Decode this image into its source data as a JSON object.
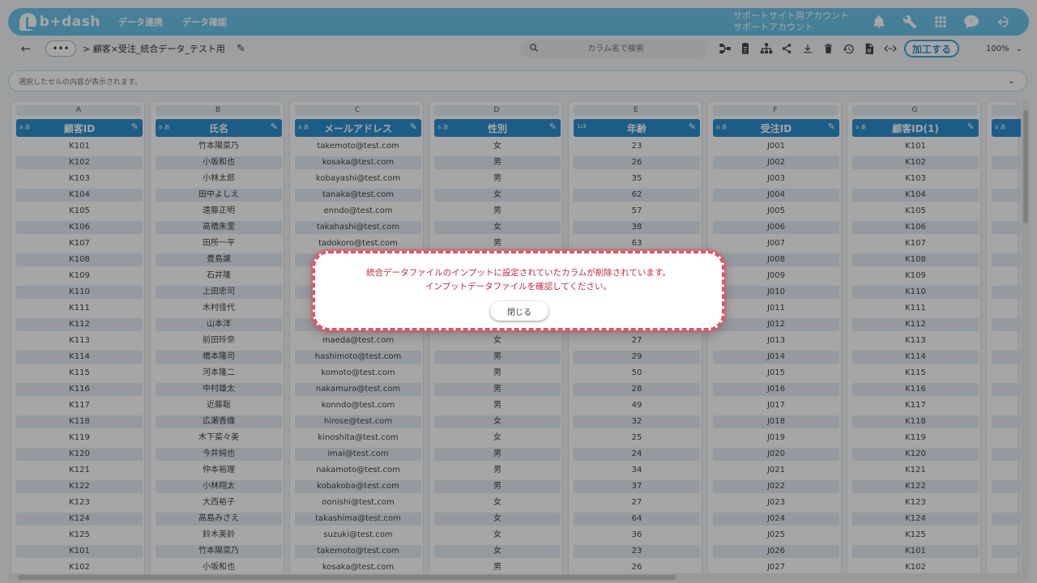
{
  "app": {
    "logo_text": "b+dash",
    "nav": [
      "データ連携",
      "データ確認"
    ],
    "account_line1": "サポートサイト用アカウント",
    "account_line2": "サポートアカウント"
  },
  "toolbar": {
    "more_label": "•••",
    "breadcrumb": "> 顧客×受注_統合データ_テスト用",
    "search_placeholder": "カラム名で検索",
    "process_label": "加工する",
    "zoom": "100%"
  },
  "cellbar": {
    "text": "選択したセルの内容が表示されます。"
  },
  "columns": [
    {
      "letter": "A",
      "type": "a あ",
      "name": "顧客ID",
      "values": [
        "K101",
        "K102",
        "K103",
        "K104",
        "K105",
        "K106",
        "K107",
        "K108",
        "K109",
        "K110",
        "K111",
        "K112",
        "K113",
        "K114",
        "K115",
        "K116",
        "K117",
        "K118",
        "K119",
        "K120",
        "K121",
        "K122",
        "K123",
        "K124",
        "K125",
        "K101",
        "K102"
      ]
    },
    {
      "letter": "B",
      "type": "a あ",
      "name": "氏名",
      "values": [
        "竹本陽菜乃",
        "小坂和也",
        "小林太郎",
        "田中よしえ",
        "遠藤正明",
        "高橋朱里",
        "田所一平",
        "豊島譲",
        "石井隆",
        "上田忠司",
        "木村佳代",
        "山本洋",
        "前田玲奈",
        "橋本隆司",
        "河本隆二",
        "中村雄太",
        "近藤聡",
        "広瀬香織",
        "木下菜々美",
        "今井純也",
        "仲本裕理",
        "小林翔太",
        "大西裕子",
        "高島みさえ",
        "鈴木美鈴",
        "竹本陽菜乃",
        "小坂和也"
      ]
    },
    {
      "letter": "C",
      "type": "a あ",
      "name": "メールアドレス",
      "values": [
        "takemoto@test.com",
        "kosaka@test.com",
        "kobayashi@test.com",
        "tanaka@test.com",
        "enndo@test.com",
        "takahashi@test.com",
        "tadokoro@test.com",
        "",
        "",
        "",
        "",
        "",
        "maeda@test.com",
        "hashimoto@test.com",
        "komoto@test.com",
        "nakamura@test.com",
        "konndo@test.com",
        "hirose@test.com",
        "kinoshita@test.com",
        "imai@test.com",
        "nakamoto@test.com",
        "kobakoba@test.com",
        "oonishi@test.com",
        "takashima@test.com",
        "suzuki@test.com",
        "takemoto@test.com",
        "kosaka@test.com"
      ]
    },
    {
      "letter": "D",
      "type": "a あ",
      "name": "性別",
      "values": [
        "女",
        "男",
        "男",
        "女",
        "男",
        "女",
        "男",
        "",
        "",
        "",
        "",
        "",
        "女",
        "男",
        "男",
        "男",
        "男",
        "女",
        "女",
        "男",
        "男",
        "男",
        "女",
        "女",
        "女",
        "女",
        "男"
      ]
    },
    {
      "letter": "E",
      "type": "1₂3",
      "name": "年齢",
      "values": [
        "23",
        "26",
        "35",
        "62",
        "57",
        "38",
        "63",
        "",
        "",
        "",
        "",
        "",
        "27",
        "29",
        "50",
        "28",
        "49",
        "32",
        "25",
        "24",
        "34",
        "37",
        "27",
        "64",
        "36",
        "23",
        "26"
      ]
    },
    {
      "letter": "F",
      "type": "a あ",
      "name": "受注ID",
      "values": [
        "J001",
        "J002",
        "J003",
        "J004",
        "J005",
        "J006",
        "J007",
        "J008",
        "J009",
        "J010",
        "J011",
        "J012",
        "J013",
        "J014",
        "J015",
        "J016",
        "J017",
        "J018",
        "J019",
        "J020",
        "J021",
        "J022",
        "J023",
        "J024",
        "J025",
        "J026",
        "J027"
      ]
    },
    {
      "letter": "G",
      "type": "a あ",
      "name": "顧客ID(1)",
      "values": [
        "K101",
        "K102",
        "K103",
        "K104",
        "K105",
        "K106",
        "K107",
        "K108",
        "K109",
        "K110",
        "K111",
        "K112",
        "K113",
        "K114",
        "K115",
        "K116",
        "K117",
        "K118",
        "K119",
        "K120",
        "K121",
        "K122",
        "K123",
        "K124",
        "K125",
        "K101",
        "K102"
      ]
    }
  ],
  "partial_column": {
    "type": "a あ"
  },
  "dialog": {
    "line1": "統合データファイルのインプットに設定されていたカラムが削除されています。",
    "line2": "インプットデータファイルを確認してください。",
    "close_label": "閉じる"
  },
  "colors": {
    "header_bg": "#6cc4ea",
    "column_header_bg": "#2b8fcf",
    "dialog_text": "#c6263b",
    "dialog_border": "#e4525f",
    "process_button": "#3da7d9"
  }
}
